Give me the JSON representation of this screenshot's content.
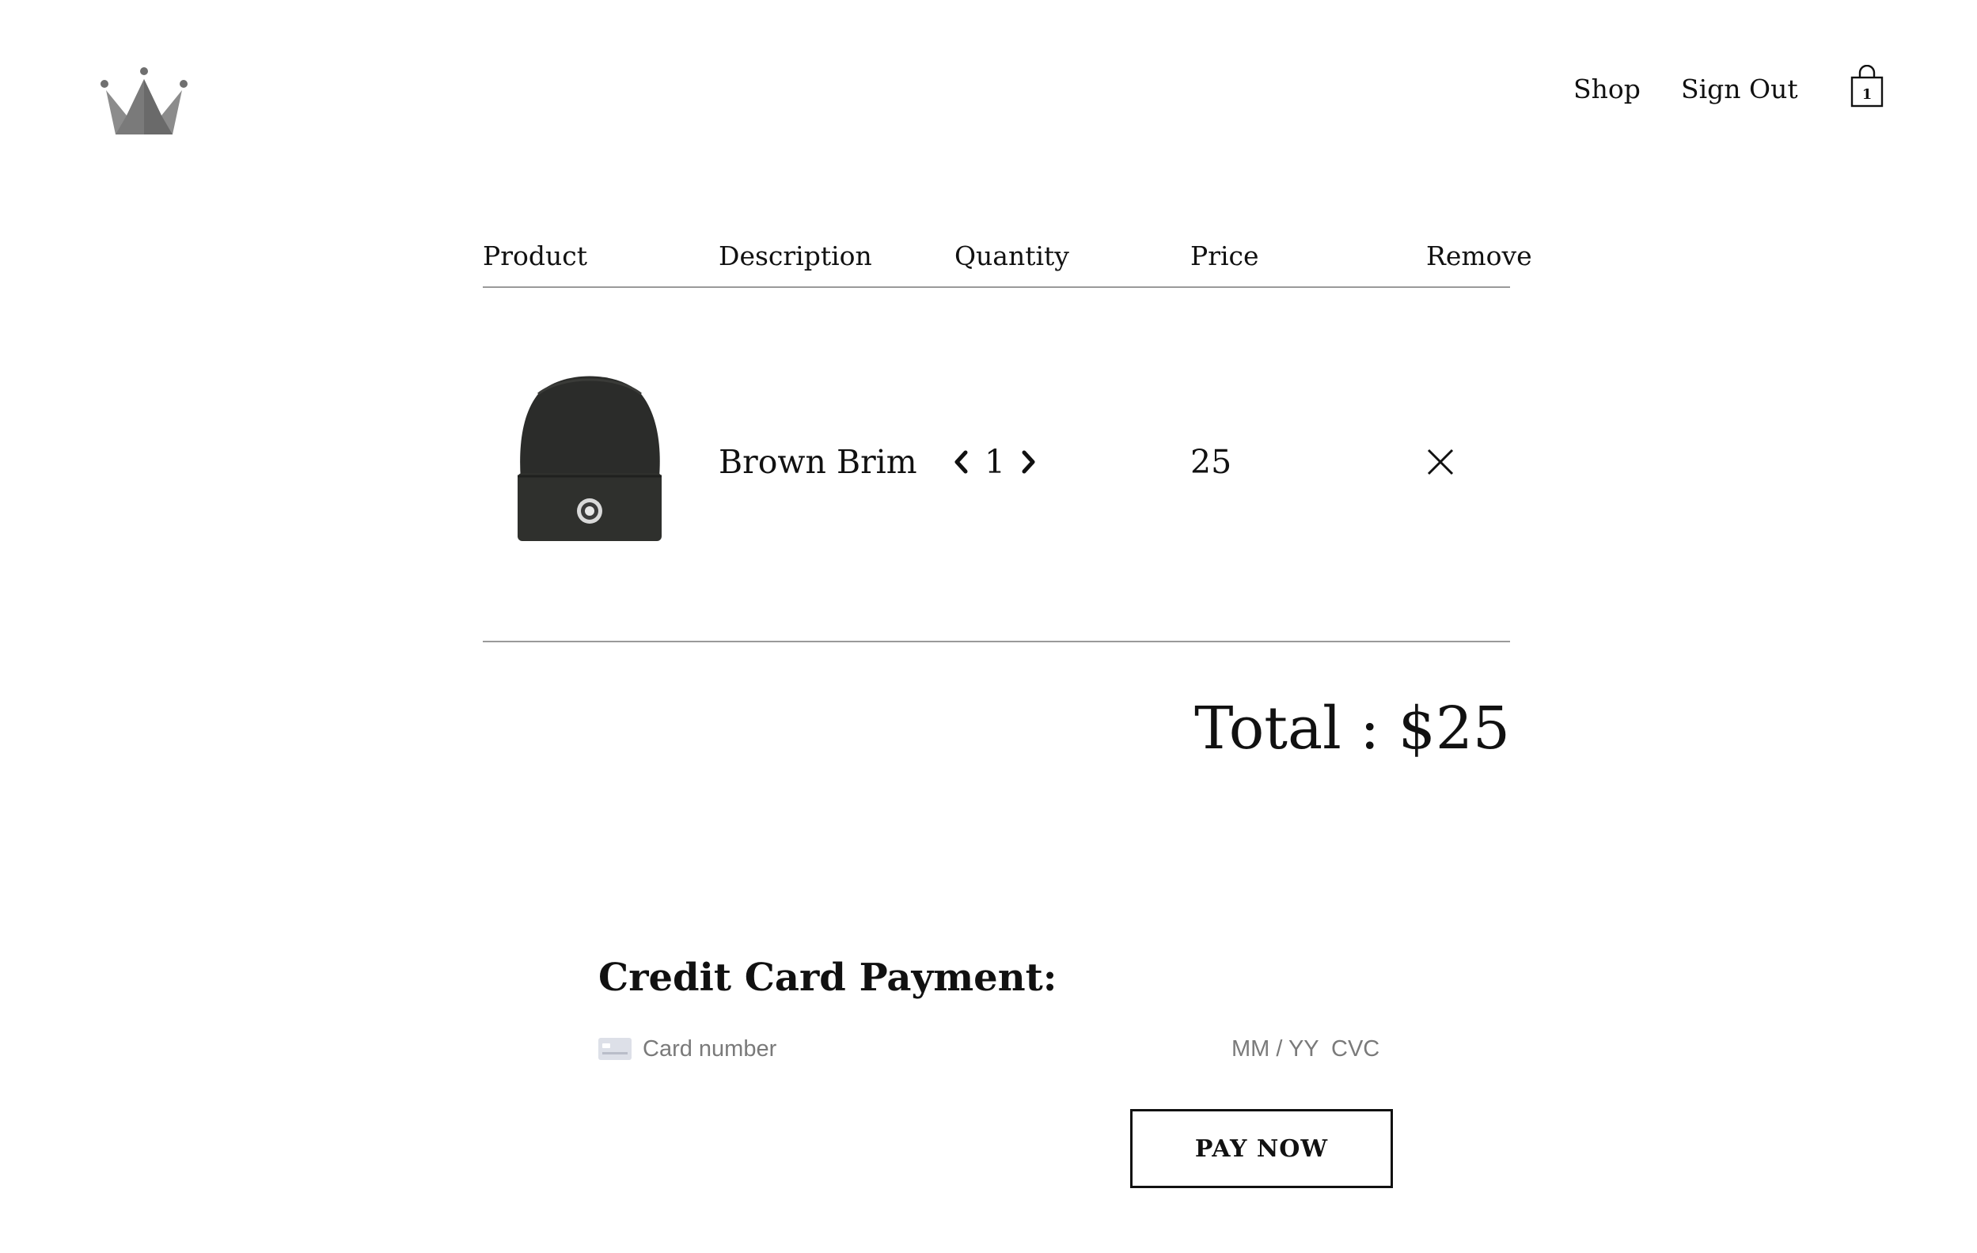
{
  "header": {
    "logo_icon": "crown-icon",
    "nav": [
      {
        "label": "Shop"
      },
      {
        "label": "Sign Out"
      }
    ],
    "cart": {
      "icon": "shopping-bag-icon",
      "count": "1"
    }
  },
  "cart_table": {
    "headers": {
      "product": "Product",
      "description": "Description",
      "quantity": "Quantity",
      "price": "Price",
      "remove": "Remove"
    },
    "items": [
      {
        "image": "black-beanie-image",
        "description": "Brown Brim",
        "quantity": "1",
        "price": "25",
        "remove_icon": "close-icon"
      }
    ]
  },
  "total": {
    "label": "Total : $25"
  },
  "payment": {
    "title": "Credit Card Payment:",
    "card_number_placeholder": "Card number",
    "expiry_placeholder": "MM / YY",
    "cvc_placeholder": "CVC",
    "pay_button": "PAY NOW"
  },
  "colors": {
    "text": "#111111",
    "divider": "#9a9a9a",
    "placeholder": "#7a7a7a",
    "logo": "#6f6f6f"
  }
}
